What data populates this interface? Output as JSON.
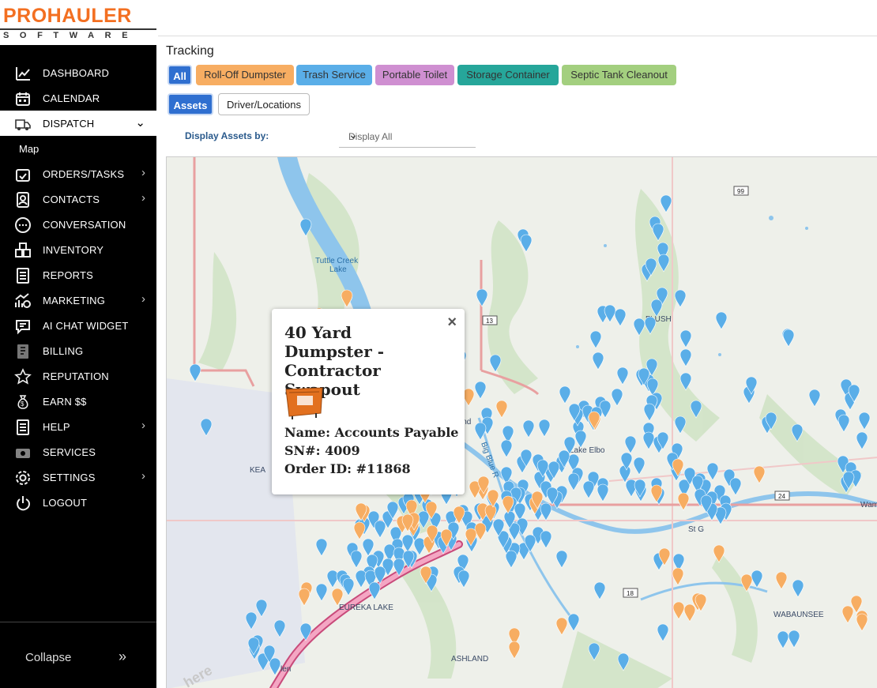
{
  "logo": {
    "line1": "PROHAULER",
    "line2": "SOFTWARE"
  },
  "sidebar": {
    "items": [
      {
        "label": "DASHBOARD",
        "icon": "chart-line-icon",
        "chevron": ""
      },
      {
        "label": "CALENDAR",
        "icon": "calendar-icon",
        "chevron": ""
      },
      {
        "label": "DISPATCH",
        "icon": "truck-icon",
        "chevron": "⌄"
      },
      {
        "label": "ORDERS/TASKS",
        "icon": "calendar-check-icon",
        "chevron": "›"
      },
      {
        "label": "CONTACTS",
        "icon": "contacts-icon",
        "chevron": "›"
      },
      {
        "label": "CONVERSATION",
        "icon": "chat-bubble-icon",
        "chevron": ""
      },
      {
        "label": "INVENTORY",
        "icon": "boxes-icon",
        "chevron": ""
      },
      {
        "label": "REPORTS",
        "icon": "report-icon",
        "chevron": ""
      },
      {
        "label": "MARKETING",
        "icon": "marketing-icon",
        "chevron": "›"
      },
      {
        "label": "AI CHAT WIDGET",
        "icon": "ai-chat-icon",
        "chevron": ""
      },
      {
        "label": "BILLING",
        "icon": "billing-icon",
        "chevron": ""
      },
      {
        "label": "REPUTATION",
        "icon": "star-icon",
        "chevron": ""
      },
      {
        "label": "EARN $$",
        "icon": "money-bag-icon",
        "chevron": ""
      },
      {
        "label": "HELP",
        "icon": "help-icon",
        "chevron": "›"
      },
      {
        "label": "SERVICES",
        "icon": "services-icon",
        "chevron": ""
      },
      {
        "label": "SETTINGS",
        "icon": "gear-icon",
        "chevron": "›"
      },
      {
        "label": "LOGOUT",
        "icon": "power-icon",
        "chevron": ""
      }
    ],
    "sub_item": "Map",
    "collapse_label": "Collapse",
    "collapse_icon": "»"
  },
  "main": {
    "title": "Tracking",
    "filters": [
      {
        "label": "All",
        "color": "#2f6fd0"
      },
      {
        "label": "Roll-Off Dumpster",
        "color": "#f7ad62"
      },
      {
        "label": "Trash Service",
        "color": "#5aaee8"
      },
      {
        "label": "Portable Toilet",
        "color": "#cf8fd1"
      },
      {
        "label": "Storage Container",
        "color": "#26a69a"
      },
      {
        "label": "Septic Tank Cleanout",
        "color": "#a3cf7f"
      }
    ],
    "view_buttons": [
      {
        "label": "Assets"
      },
      {
        "label": "Driver/Locations"
      }
    ],
    "display_label": "Display Assets by:",
    "display_value": "Display All",
    "display_chevron": "⌄"
  },
  "map": {
    "labels": [
      {
        "text": "Tuttle Creek"
      },
      {
        "text": "Lake"
      },
      {
        "text": "FLUSH"
      },
      {
        "text": "Lake Elbo"
      },
      {
        "text": "Pond"
      },
      {
        "text": "Big Blue R"
      },
      {
        "text": "KEA"
      },
      {
        "text": "St G"
      },
      {
        "text": "EUREKA LAKE"
      },
      {
        "text": "ASHLAND"
      },
      {
        "text": "WABAUNSEE"
      },
      {
        "text": "Wam"
      },
      {
        "text": "len"
      },
      {
        "text": "here"
      }
    ],
    "shields": [
      {
        "text": "99"
      },
      {
        "text": "13"
      },
      {
        "text": "24"
      },
      {
        "text": "18"
      }
    ],
    "popup": {
      "title": "40 Yard Dumpster - Contractor Swapout",
      "name": "Name: Accounts Payable",
      "sn": "SN#: 4009",
      "order": "Order ID: #11868",
      "close": "×"
    }
  }
}
